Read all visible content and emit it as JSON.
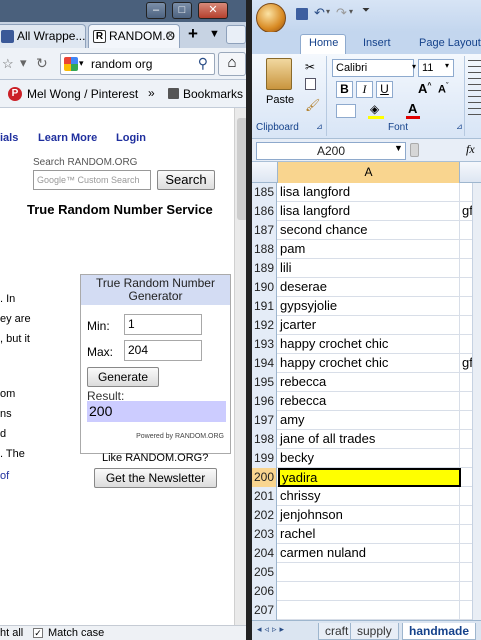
{
  "browser": {
    "tabs": [
      {
        "label": "All Wrappe..."
      },
      {
        "label": "RANDOM.O"
      }
    ],
    "url": "random org",
    "bookmarks": {
      "pinterest": "Mel Wong / Pinterest",
      "bookmarks": "Bookmarks"
    },
    "status": {
      "highlight": "ht all",
      "match_case": "Match case"
    }
  },
  "page": {
    "nav": {
      "partial": "ials",
      "learn_more": "Learn More",
      "login": "Login"
    },
    "search_label": "Search RANDOM.ORG",
    "search_placeholder": "Google™ Custom Search",
    "search_button": "Search",
    "heading": "True Random Number Service",
    "left_fragments": [
      ". In",
      "ey are",
      ", but it",
      "om",
      "ns",
      "d",
      ". The",
      "of"
    ],
    "generator": {
      "title": "True Random Number Generator",
      "min_label": "Min:",
      "min_value": "1",
      "max_label": "Max:",
      "max_value": "204",
      "generate_button": "Generate",
      "result_label": "Result:",
      "result_value": "200",
      "powered_by": "Powered by RANDOM.ORG"
    },
    "like_text": "Like RANDOM.ORG?",
    "newsletter_button": "Get the Newsletter"
  },
  "excel": {
    "ribbon_tabs": [
      "Home",
      "Insert",
      "Page Layout"
    ],
    "font_name": "Calibri",
    "font_size": "11",
    "groups": {
      "clipboard": "Clipboard",
      "font": "Font",
      "paste": "Paste"
    },
    "name_box": "A200",
    "formula_icon": "fx",
    "column_header": "A",
    "rows": [
      {
        "n": "185",
        "a": "lisa langford",
        "b": ""
      },
      {
        "n": "186",
        "a": "lisa langford",
        "b": "gfc"
      },
      {
        "n": "187",
        "a": "second chance",
        "b": ""
      },
      {
        "n": "188",
        "a": "pam",
        "b": ""
      },
      {
        "n": "189",
        "a": "lili",
        "b": ""
      },
      {
        "n": "190",
        "a": "deserae",
        "b": ""
      },
      {
        "n": "191",
        "a": "gypsyjolie",
        "b": ""
      },
      {
        "n": "192",
        "a": "jcarter",
        "b": ""
      },
      {
        "n": "193",
        "a": "happy crochet chic",
        "b": ""
      },
      {
        "n": "194",
        "a": "happy crochet chic",
        "b": "gfc"
      },
      {
        "n": "195",
        "a": "rebecca",
        "b": ""
      },
      {
        "n": "196",
        "a": "rebecca",
        "b": ""
      },
      {
        "n": "197",
        "a": "amy",
        "b": ""
      },
      {
        "n": "198",
        "a": "jane of all trades",
        "b": ""
      },
      {
        "n": "199",
        "a": "becky",
        "b": ""
      },
      {
        "n": "200",
        "a": "yadira",
        "b": ""
      },
      {
        "n": "201",
        "a": "chrissy",
        "b": ""
      },
      {
        "n": "202",
        "a": "jenjohnson",
        "b": ""
      },
      {
        "n": "203",
        "a": "rachel",
        "b": ""
      },
      {
        "n": "204",
        "a": "carmen nuland",
        "b": ""
      },
      {
        "n": "205",
        "a": "",
        "b": ""
      },
      {
        "n": "206",
        "a": "",
        "b": ""
      },
      {
        "n": "207",
        "a": "",
        "b": ""
      }
    ],
    "selected_row": "200",
    "sheet_tabs": [
      "craft",
      "supply",
      "handmade"
    ],
    "active_sheet": "handmade"
  }
}
